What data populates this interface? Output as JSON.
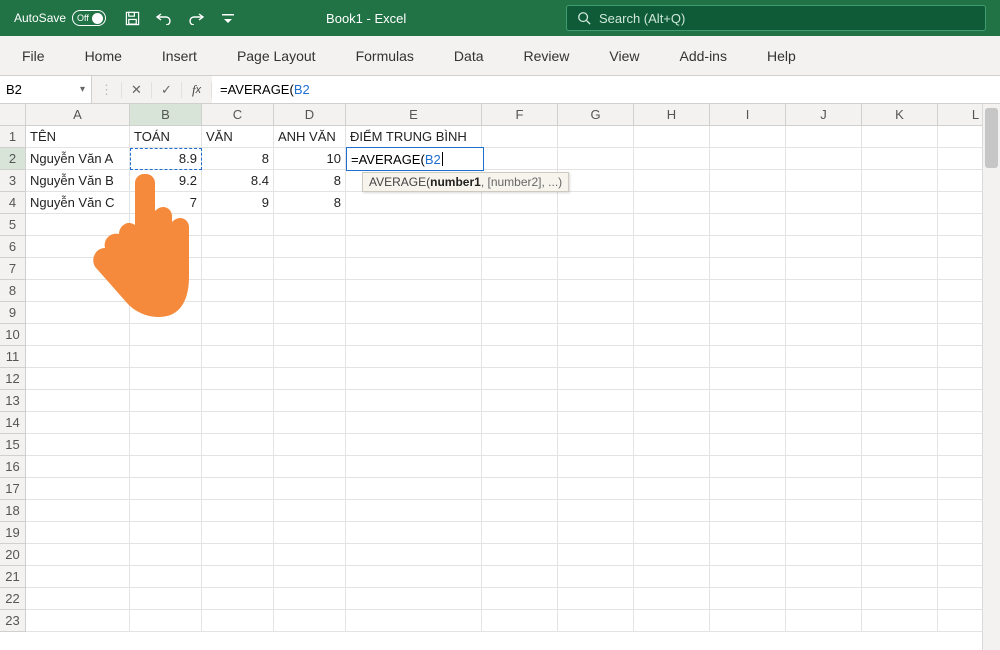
{
  "titlebar": {
    "autosave_label": "AutoSave",
    "autosave_state": "Off",
    "doc_title": "Book1 - Excel",
    "search_placeholder": "Search (Alt+Q)"
  },
  "ribbon": {
    "tabs": [
      "File",
      "Home",
      "Insert",
      "Page Layout",
      "Formulas",
      "Data",
      "Review",
      "View",
      "Add-ins",
      "Help"
    ]
  },
  "formula_bar": {
    "namebox": "B2",
    "formula_prefix": "=AVERAGE(",
    "formula_ref": "B2",
    "fn_tooltip_name": "AVERAGE(",
    "fn_tooltip_bold": "number1",
    "fn_tooltip_rest": ", [number2], ...)"
  },
  "columns": [
    "A",
    "B",
    "C",
    "D",
    "E",
    "F",
    "G",
    "H",
    "I",
    "J",
    "K",
    "L"
  ],
  "row_count": 23,
  "selected": {
    "namebox_ref": "B2",
    "editing_cell": "E2"
  },
  "headers": {
    "A": "TÊN",
    "B": "TOÁN",
    "C": "VĂN",
    "D": "ANH VĂN",
    "E": "ĐIỂM TRUNG BÌNH"
  },
  "rows": [
    {
      "name": "Nguyễn Văn A",
      "toan": "8.9",
      "van": "8",
      "anhvan": "10"
    },
    {
      "name": "Nguyễn Văn B",
      "toan": "9.2",
      "van": "8.4",
      "anhvan": "8"
    },
    {
      "name": "Nguyễn Văn C",
      "toan": "7",
      "van": "9",
      "anhvan": "8"
    }
  ],
  "editing_cell_content_prefix": "=AVERAGE(",
  "editing_cell_content_ref": "B2",
  "cursor_hint": "pointing-hand"
}
